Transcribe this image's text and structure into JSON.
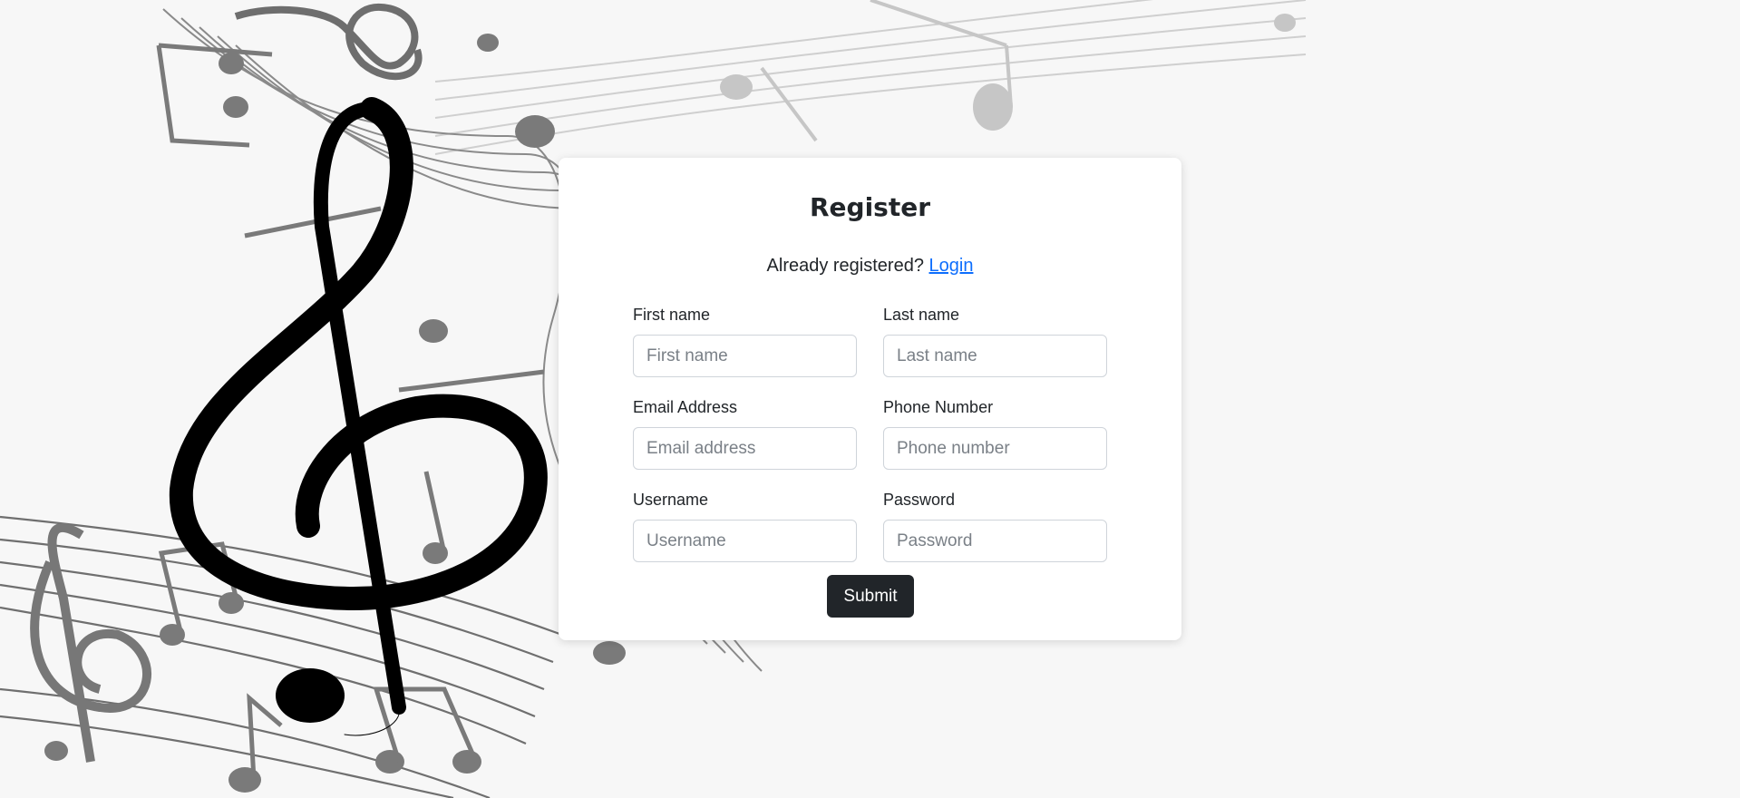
{
  "form": {
    "title": "Register",
    "already_text": "Already registered? ",
    "login_link": "Login",
    "submit_label": "Submit",
    "fields": {
      "first_name": {
        "label": "First name",
        "placeholder": "First name"
      },
      "last_name": {
        "label": "Last name",
        "placeholder": "Last name"
      },
      "email": {
        "label": "Email Address",
        "placeholder": "Email address"
      },
      "phone": {
        "label": "Phone Number",
        "placeholder": "Phone number"
      },
      "username": {
        "label": "Username",
        "placeholder": "Username"
      },
      "password": {
        "label": "Password",
        "placeholder": "Password"
      }
    }
  },
  "background": {
    "illustration": "music-notes-treble-clef",
    "colors": {
      "page": "#f7f7f7",
      "ink": "#000000",
      "staff": "#777777"
    }
  },
  "theme": {
    "link_color": "#0d6efd",
    "button_color": "#212529"
  }
}
